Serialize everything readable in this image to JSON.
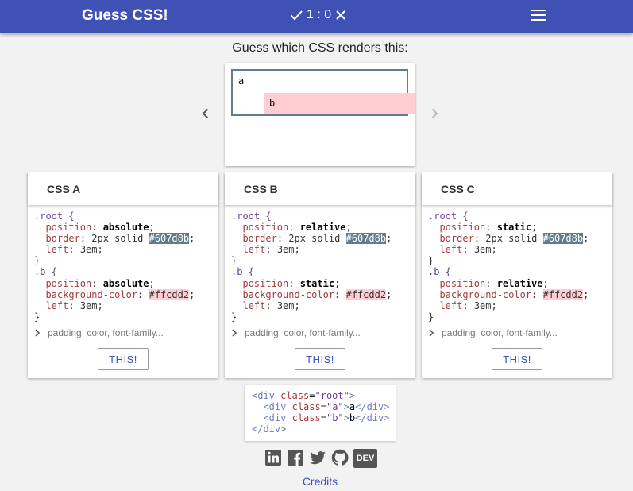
{
  "header": {
    "title": "Guess CSS!",
    "score_text": "1 : 0",
    "accent_color": "#3f51b5"
  },
  "question": "Guess which CSS renders this:",
  "preview": {
    "a_text": "a",
    "b_text": "b"
  },
  "options": [
    {
      "title": "CSS A",
      "root_selector": ".root {",
      "root_position": "absolute",
      "border_value": "2px solid",
      "border_color": "#607d8b",
      "left_value": "3em",
      "b_selector": ".b {",
      "b_position": "absolute",
      "bg_color": "#ffcdd2",
      "b_left_value": "3em",
      "more_text": "padding, color, font-family...",
      "button_label": "THIS!"
    },
    {
      "title": "CSS B",
      "root_selector": ".root {",
      "root_position": "relative",
      "border_value": "2px solid",
      "border_color": "#607d8b",
      "left_value": "3em",
      "b_selector": ".b {",
      "b_position": "static",
      "bg_color": "#ffcdd2",
      "b_left_value": "3em",
      "more_text": "padding, color, font-family...",
      "button_label": "THIS!"
    },
    {
      "title": "CSS C",
      "root_selector": ".root {",
      "root_position": "static",
      "border_value": "2px solid",
      "border_color": "#607d8b",
      "left_value": "3em",
      "b_selector": ".b {",
      "b_position": "relative",
      "bg_color": "#ffcdd2",
      "b_left_value": "3em",
      "more_text": "padding, color, font-family...",
      "button_label": "THIS!"
    }
  ],
  "html_code": {
    "root_class": "root",
    "a_class": "a",
    "a_text": "a",
    "b_class": "b",
    "b_text": "b"
  },
  "social": [
    "linkedin-icon",
    "facebook-icon",
    "twitter-icon",
    "github-icon",
    "dev-icon"
  ],
  "dev_label": "DEV",
  "credits": "Credits"
}
